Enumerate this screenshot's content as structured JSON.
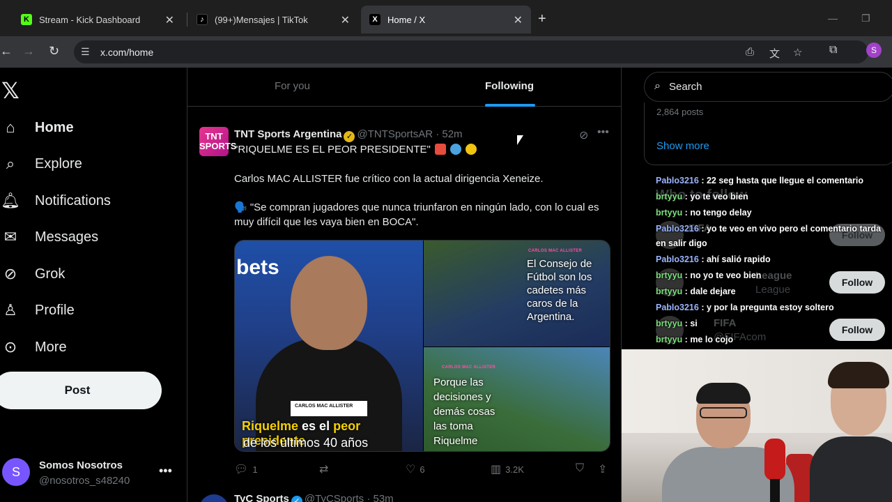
{
  "browser": {
    "tabs": [
      {
        "title": "Stream - Kick Dashboard",
        "favicon": "K"
      },
      {
        "title": "(99+)Mensajes | TikTok",
        "favicon": "♪"
      },
      {
        "title": "Home / X",
        "favicon": "X"
      }
    ],
    "url": "x.com/home",
    "profile_initial": "S"
  },
  "sidebar": {
    "items": [
      {
        "label": "Home",
        "icon": "home-icon"
      },
      {
        "label": "Explore",
        "icon": "search-icon"
      },
      {
        "label": "Notifications",
        "icon": "bell-icon"
      },
      {
        "label": "Messages",
        "icon": "mail-icon"
      },
      {
        "label": "Grok",
        "icon": "grok-icon"
      },
      {
        "label": "Profile",
        "icon": "person-icon"
      },
      {
        "label": "More",
        "icon": "more-circle-icon"
      }
    ],
    "post_label": "Post",
    "account": {
      "initial": "S",
      "name": "Somos Nosotros",
      "handle": "@nosotros_s48240"
    }
  },
  "feed": {
    "tabs": {
      "for_you": "For you",
      "following": "Following"
    },
    "tweet": {
      "name": "TNT Sports Argentina",
      "handle": "@TNTSportsAR",
      "time": "· 52m",
      "avatar_text": "TNT SPORTS",
      "line1": "\"RIQUELME ES EL PEOR PRESIDENTE\"",
      "line2": "Carlos MAC ALLISTER fue crítico con la actual dirigencia Xeneize.",
      "line3": "🗣️ \"Se compran jugadores que nunca triunfaron en ningún lado, con lo cual es muy difícil que les vaya bien en BOCA\".",
      "media": {
        "bets": "bets",
        "quote_name": "CARLOS MAC ALLISTER",
        "caption_a": "Riquelme",
        "caption_b": " es el ",
        "caption_c": "peor presidente",
        "caption_d": "de los últimos 40 años",
        "tag_top": "CARLOS MAC ALLISTER",
        "text_top": "El Consejo de Fútbol son los cadetes más caros de la Argentina.",
        "tag_bottom": "CARLOS MAC ALLISTER",
        "text_bottom": "Porque las decisiones y demás cosas las toma Riquelme"
      },
      "stats": {
        "replies": "1",
        "reposts": "",
        "likes": "6",
        "views": "3.2K"
      }
    },
    "next_tweet": {
      "name": "TyC Sports",
      "handle": "@TyCSports",
      "time": "· 53m"
    }
  },
  "right": {
    "search_placeholder": "Search",
    "posts_count": "2,864 posts",
    "show_more": "Show more",
    "who_to_follow": "Who to follow",
    "suggestions": [
      {
        "name": "FIFA",
        "handle": "a"
      },
      {
        "name": "League",
        "handle": "League"
      },
      {
        "name": "FIFA",
        "handle": "@FIFAcom"
      }
    ],
    "follow_label": "Follow"
  },
  "chat": [
    {
      "user": "Pablo3216",
      "msg": "22 seg hasta que llegue el comentario",
      "color": "u1"
    },
    {
      "user": "brtyyu",
      "msg": "yo te veo bien",
      "color": "u2"
    },
    {
      "user": "brtyyu",
      "msg": "no tengo delay",
      "color": "u2"
    },
    {
      "user": "Pablo3216",
      "msg": "yo te veo en vivo pero el comentario tarda",
      "color": "u1"
    },
    {
      "user": "",
      "msg": "en salir digo",
      "color": "u1"
    },
    {
      "user": "Pablo3216",
      "msg": "ahí salió rapido",
      "color": "u1"
    },
    {
      "user": "brtyyu",
      "msg": "no yo te veo bien",
      "color": "u2"
    },
    {
      "user": "brtyyu",
      "msg": "dale dejare",
      "color": "u2"
    },
    {
      "user": "Pablo3216",
      "msg": "y por la pregunta estoy soltero",
      "color": "u1"
    },
    {
      "user": "brtyyu",
      "msg": "si",
      "color": "u2"
    },
    {
      "user": "brtyyu",
      "msg": "me lo cojo",
      "color": "u2"
    }
  ]
}
